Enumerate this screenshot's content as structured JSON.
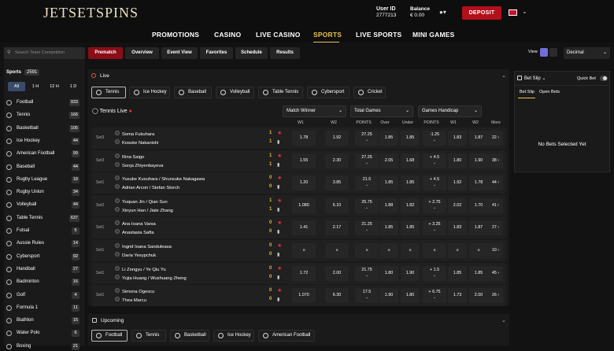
{
  "header": {
    "logo": "JETSETSPINS",
    "user_id_label": "User ID",
    "user_id": "2777213",
    "balance_label": "Balance",
    "balance": "€ 0.00",
    "deposit": "DEPOSIT"
  },
  "nav": [
    "PROMOTIONS",
    "CASINO",
    "LIVE CASINO",
    "SPORTS",
    "LIVE SPORTS",
    "MINI GAMES"
  ],
  "nav_active": "SPORTS",
  "sidebar": {
    "search_placeholder": "Search Team Competition",
    "sports_label": "Sports",
    "sports_count": "2591",
    "time_filters": [
      "All",
      "1 H",
      "12 H",
      "1 D"
    ],
    "items": [
      {
        "label": "Football",
        "count": "933"
      },
      {
        "label": "Tennis",
        "count": "166"
      },
      {
        "label": "Basketball",
        "count": "105"
      },
      {
        "label": "Ice Hockey",
        "count": "44"
      },
      {
        "label": "American Football",
        "count": "99"
      },
      {
        "label": "Baseball",
        "count": "44"
      },
      {
        "label": "Rugby League",
        "count": "18"
      },
      {
        "label": "Rugby Union",
        "count": "34"
      },
      {
        "label": "Volleyball",
        "count": "44"
      },
      {
        "label": "Table Tennis",
        "count": "637"
      },
      {
        "label": "Futsal",
        "count": "5"
      },
      {
        "label": "Aussie Rules",
        "count": "14"
      },
      {
        "label": "Cybersport",
        "count": "92"
      },
      {
        "label": "Handball",
        "count": "27"
      },
      {
        "label": "Badminton",
        "count": "16"
      },
      {
        "label": "Golf",
        "count": "4"
      },
      {
        "label": "Formula 1",
        "count": "11"
      },
      {
        "label": "Biathlon",
        "count": "15"
      },
      {
        "label": "Water Polo",
        "count": "6"
      },
      {
        "label": "Boxing",
        "count": "21"
      }
    ]
  },
  "tabs": [
    "Prematch",
    "Overview",
    "Event View",
    "Favorites",
    "Schedule",
    "Results"
  ],
  "view": {
    "label": "View",
    "odds_format": "Decimal"
  },
  "live": {
    "title": "Live",
    "sport_tabs": [
      "Tennis",
      "Ice Hockey",
      "Baseball",
      "Volleyball",
      "Table Tennis",
      "Cybersport",
      "Cricket"
    ],
    "section_title": "Tennis Live",
    "dropdowns": [
      "Match Winner",
      "Total Games",
      "Games Handicap"
    ],
    "columns": [
      "W1",
      "W2",
      "POINTS",
      "Over",
      "Under",
      "POINTS",
      "W1",
      "W2",
      "More"
    ],
    "matches": [
      {
        "set": "Set3",
        "p1": "Soma Fukuhara",
        "p2": "Kosuke Nakanishi",
        "s1": "1",
        "s2": "1",
        "w1": "1.78",
        "w2": "1.92",
        "pts": "27.25",
        "over": "1.85",
        "under": "1.85",
        "hpts": "-1.25",
        "hw1": "1.83",
        "hw2": "1.87",
        "more": "22"
      },
      {
        "set": "Set3",
        "p1": "Rina Saigo",
        "p2": "Sonja Zhiyenbayeva",
        "s1": "1",
        "s2": "1",
        "w1": "1.55",
        "w2": "2.30",
        "pts": "27.25",
        "over": "2.05",
        "under": "1.68",
        "hpts": "+ 4.5",
        "hw1": "1.80",
        "hw2": "1.90",
        "more": "38"
      },
      {
        "set": "Set1",
        "p1": "Yusuke Kusuhara / Shunsuke Nakagawa",
        "p2": "Adrian Arcon / Stefan Storch",
        "s1": "0",
        "s2": "0",
        "w1": "1.20",
        "w2": "3.85",
        "pts": "21.5",
        "over": "1.85",
        "under": "1.85",
        "hpts": "+ 4.5",
        "hw1": "1.92",
        "hw2": "1.78",
        "more": "44"
      },
      {
        "set": "Set2",
        "p1": "Yuquan Jin / Qian Sun",
        "p2": "Xinyun Han / Jiale Zhang",
        "s1": "1",
        "s2": "1",
        "w1": "1.080",
        "w2": "6.10",
        "pts": "25.75",
        "over": "1.88",
        "under": "1.82",
        "hpts": "+ 2.75",
        "hw1": "2.02",
        "hw2": "1.70",
        "more": "41"
      },
      {
        "set": "Set1",
        "p1": "Ana Ioana Varsa",
        "p2": "Anastasia Safta",
        "s1": "0",
        "s2": "0",
        "w1": "1.41",
        "w2": "2.17",
        "pts": "21.25",
        "over": "1.85",
        "under": "1.85",
        "hpts": "+ 3.25",
        "hw1": "1.83",
        "hw2": "1.87",
        "more": "27"
      },
      {
        "set": "Set1",
        "p1": "Ingrid Ioana Sanduleasa",
        "p2": "Daria Yesypchuk",
        "s1": "0",
        "s2": "0",
        "w1": "",
        "w2": "",
        "pts": "",
        "over": "",
        "under": "",
        "hpts": "",
        "hw1": "",
        "hw2": "",
        "more": "10",
        "locked": true
      },
      {
        "set": "Set1",
        "p1": "Li Zongyu / Ye Qiu Yu",
        "p2": "Yujia Huang / Wushuang Zheng",
        "s1": "0",
        "s2": "0",
        "w1": "1.72",
        "w2": "2.00",
        "pts": "21.75",
        "over": "1.80",
        "under": "1.90",
        "hpts": "+ 1.5",
        "hw1": "1.85",
        "hw2": "1.85",
        "more": "45"
      },
      {
        "set": "Set1",
        "p1": "Simona Ogescu",
        "p2": "Thea Marcu",
        "s1": "0",
        "s2": "0",
        "w1": "1.070",
        "w2": "6.30",
        "pts": "17.5",
        "over": "1.90",
        "under": "1.80",
        "hpts": "+ 6.75",
        "hw1": "1.73",
        "hw2": "2.00",
        "more": "26"
      }
    ]
  },
  "upcoming": {
    "title": "Upcoming",
    "sport_tabs": [
      "Football",
      "Tennis",
      "Basketball",
      "Ice Hockey",
      "American Football"
    ]
  },
  "betslip": {
    "title": "Bet Slip",
    "quick_bet": "Quick Bet",
    "tabs": [
      "Bet Slip",
      "Open Bets"
    ],
    "empty": "No Bets Selected Yet"
  },
  "colors": {
    "accent": "#e6c34d",
    "deposit": "#b3101c",
    "prematch": "#8b0d17",
    "score": "#e9b23b",
    "live": "#e33333"
  }
}
